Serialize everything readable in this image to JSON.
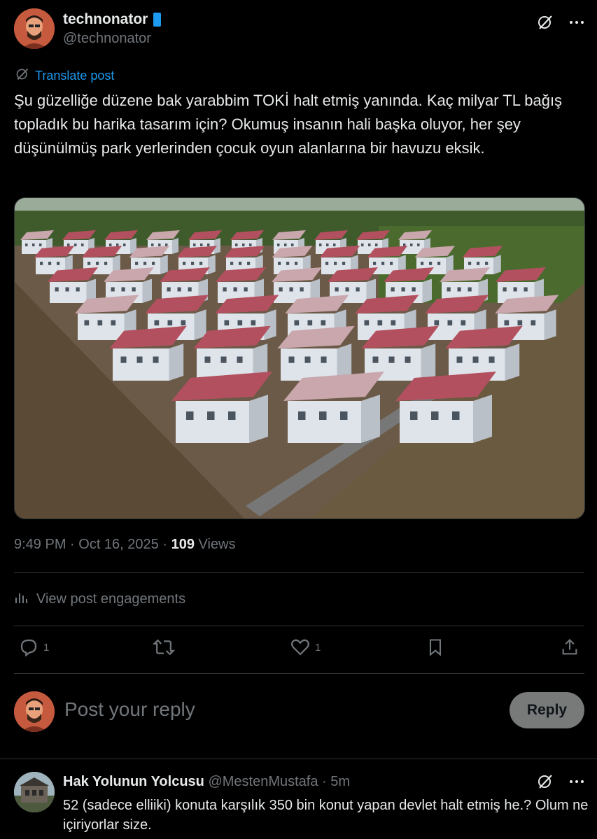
{
  "post": {
    "author_name": "technonator",
    "author_handle": "@technonator",
    "translate_label": "Translate post",
    "text": "Şu güzelliğe düzene bak yarabbim TOKİ halt etmiş yanında. Kaç milyar TL bağış topladık bu harika tasarım için? Okumuş insanın hali başka oluyor, her şey düşünülmüş park yerlerinden çocuk oyun alanlarına bir havuzu eksik.",
    "time": "9:49 PM",
    "date": "Oct 16, 2025",
    "views_count": "109",
    "views_label": "Views",
    "engagements_label": "View post engagements",
    "replies": "1",
    "reposts": "",
    "likes": "1"
  },
  "reply_box": {
    "placeholder": "Post your reply",
    "button_label": "Reply"
  },
  "comment": {
    "author_name": "Hak Yolunun Yolcusu",
    "author_handle": "@MestenMustafa",
    "time": "5m",
    "text": "52 (sadece elliiki) konuta karşılık 350 bin konut yapan devlet halt etmiş he.? Olum ne içiriyorlar size."
  },
  "icons": {
    "verified": "verified-badge-icon",
    "grok": "grok-icon",
    "more": "more-icon",
    "reply": "reply-icon",
    "repost": "repost-icon",
    "like": "like-icon",
    "bookmark": "bookmark-icon",
    "share": "share-icon",
    "analytics": "analytics-icon"
  },
  "colors": {
    "background": "#000000",
    "text": "#e7e9ea",
    "muted": "#71767b",
    "accent": "#1d9bf0",
    "border": "#2f3336"
  }
}
